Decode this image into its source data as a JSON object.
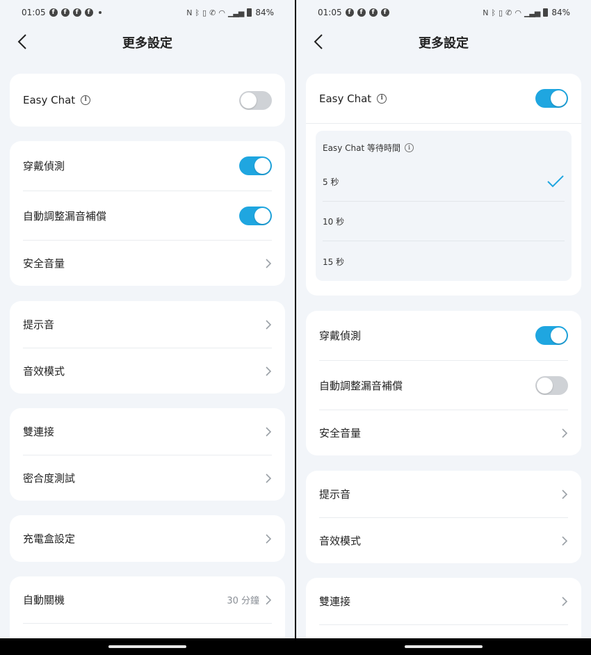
{
  "status": {
    "time": "01:05",
    "battery": "84%"
  },
  "header": {
    "title": "更多設定"
  },
  "left": {
    "easy_chat": {
      "label": "Easy Chat",
      "on": false
    },
    "wear_detect": {
      "label": "穿戴偵測",
      "on": true
    },
    "auto_leak": {
      "label": "自動調整漏音補償",
      "on": true
    },
    "safe_volume": {
      "label": "安全音量"
    },
    "prompt_sound": {
      "label": "提示音"
    },
    "sound_mode": {
      "label": "音效模式"
    },
    "dual_connect": {
      "label": "雙連接"
    },
    "fit_test": {
      "label": "密合度測試"
    },
    "case_settings": {
      "label": "充電盒設定"
    },
    "auto_off": {
      "label": "自動關機",
      "value": "30 分鐘"
    }
  },
  "right": {
    "easy_chat": {
      "label": "Easy Chat",
      "on": true
    },
    "wait_time": {
      "title": "Easy Chat 等待時間",
      "options": [
        "5 秒",
        "10 秒",
        "15 秒"
      ],
      "selected_index": 0
    },
    "wear_detect": {
      "label": "穿戴偵測",
      "on": true
    },
    "auto_leak": {
      "label": "自動調整漏音補償",
      "on": false
    },
    "safe_volume": {
      "label": "安全音量"
    },
    "prompt_sound": {
      "label": "提示音"
    },
    "sound_mode": {
      "label": "音效模式"
    },
    "dual_connect": {
      "label": "雙連接"
    }
  },
  "colors": {
    "accent": "#1fa6e0",
    "toggle_off": "#cfd2d6",
    "background": "#f2f5f9"
  }
}
